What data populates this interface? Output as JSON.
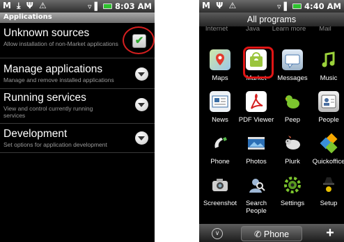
{
  "left_screen": {
    "status_bar": {
      "left_icons": "M ⤓ Ψ ⚠",
      "time": "8:03 AM"
    },
    "section_header": "Applications",
    "settings": [
      {
        "title": "Unknown sources",
        "subtitle": "Allow installation of non-Market applications",
        "control": "checkbox",
        "checked": true,
        "check_glyph": "✔"
      },
      {
        "title": "Manage applications",
        "subtitle": "Manage and remove installed applications",
        "control": "expand-arrow"
      },
      {
        "title": "Running services",
        "subtitle": "View and control currently running services",
        "control": "expand-arrow"
      },
      {
        "title": "Development",
        "subtitle": "Set options for application development",
        "control": "expand-arrow"
      }
    ],
    "highlight_color": "#d41f1f"
  },
  "right_screen": {
    "status_bar": {
      "left_icons": "M Ψ ⚠",
      "time": "4:40 AM"
    },
    "header": "All programs",
    "cut_off_labels": [
      "Internet",
      "Java",
      "Learn more",
      "Mail"
    ],
    "apps": [
      {
        "label": "Maps",
        "icon": "maps-icon"
      },
      {
        "label": "Market",
        "icon": "market-icon",
        "highlighted": true
      },
      {
        "label": "Messages",
        "icon": "messages-icon"
      },
      {
        "label": "Music",
        "icon": "music-icon"
      },
      {
        "label": "News",
        "icon": "news-icon"
      },
      {
        "label": "PDF Viewer",
        "icon": "pdf-viewer-icon"
      },
      {
        "label": "Peep",
        "icon": "peep-icon"
      },
      {
        "label": "People",
        "icon": "people-icon"
      },
      {
        "label": "Phone",
        "icon": "phone-icon"
      },
      {
        "label": "Photos",
        "icon": "photos-icon"
      },
      {
        "label": "Plurk",
        "icon": "plurk-icon"
      },
      {
        "label": "Quickoffice",
        "icon": "quickoffice-icon"
      },
      {
        "label": "Screenshot",
        "icon": "camera-icon"
      },
      {
        "label": "Search People",
        "icon": "search-people-icon"
      },
      {
        "label": "Settings",
        "icon": "settings-icon"
      },
      {
        "label": "Setup",
        "icon": "setup-icon"
      }
    ],
    "bottom_bar": {
      "phone_label": "Phone",
      "plus_glyph": "+",
      "down_glyph": "∨"
    },
    "highlight_color": "#e01515"
  }
}
